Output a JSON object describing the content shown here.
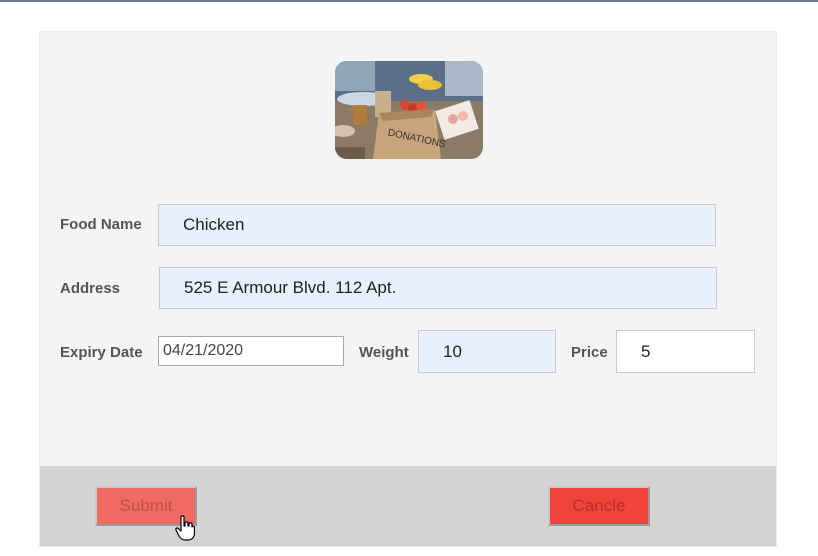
{
  "form": {
    "image_alt": "DONATIONS",
    "food_name": {
      "label": "Food Name",
      "value": "Chicken"
    },
    "address": {
      "label": "Address",
      "value": "525 E Armour Blvd. 112 Apt."
    },
    "expiry_date": {
      "label": "Expiry Date",
      "value": "04/21/2020"
    },
    "weight": {
      "label": "Weight",
      "value": "10"
    },
    "price": {
      "label": "Price",
      "value": "5"
    }
  },
  "actions": {
    "submit_label": "Submit",
    "cancel_label": "Cancle"
  },
  "colors": {
    "input_autofill_bg": "#e8f0fe",
    "submit_bg": "#ef6a62",
    "cancel_bg": "#f0443b",
    "footer_bg": "#d3d3d3"
  }
}
